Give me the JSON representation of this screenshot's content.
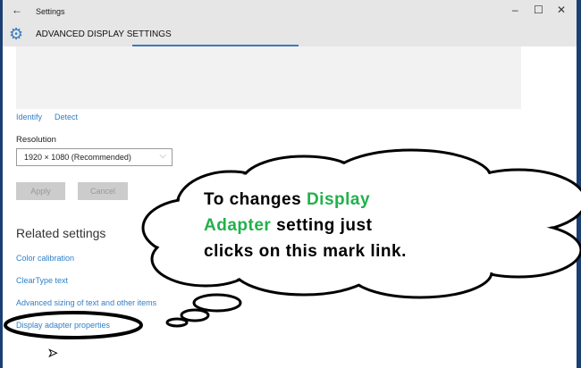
{
  "window": {
    "title": "Settings",
    "back_icon": "back-arrow",
    "minimize": "–",
    "maximize": "☐",
    "close": "✕"
  },
  "header": {
    "title": "ADVANCED DISPLAY SETTINGS"
  },
  "display": {
    "identify": "Identify",
    "detect": "Detect"
  },
  "resolution": {
    "label": "Resolution",
    "value": "1920 × 1080 (Recommended)"
  },
  "buttons": {
    "apply": "Apply",
    "cancel": "Cancel"
  },
  "related": {
    "heading": "Related settings",
    "links": [
      "Color calibration",
      "ClearType text",
      "Advanced sizing of text and other items",
      "Display adapter properties"
    ]
  },
  "annotation": {
    "line1_a": "To changes ",
    "line1_b": "Display",
    "line2_a": "Adapter",
    "line2_b": " setting just",
    "line3": "clicks on this mark link.",
    "highlight_color": "#21b14b"
  }
}
